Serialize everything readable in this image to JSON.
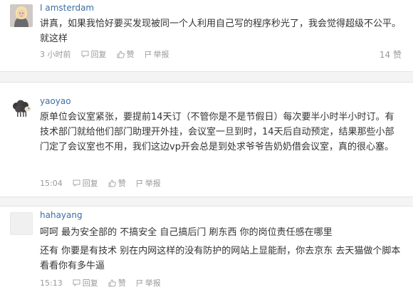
{
  "comments": [
    {
      "author": "I amsterdam",
      "body": "讲真，如果我恰好要买发现被同一个人利用自己写的程序秒光了，我会觉得超级不公平。就这样",
      "time": "3 小时前",
      "reply_label": "回复",
      "like_label": "赞",
      "report_label": "举报",
      "like_count": "14 赞",
      "avatar_icon": "female-avatar-icon"
    },
    {
      "author": "yaoyao",
      "body": "原单位会议室紧张，要提前14天订（不管你是不是节假日）每次要半小时半小时订。有技术部门就给他们部门助理开外挂，会议室一旦到时，14天后自动预定，结果那些小部门定了会议室也不用，我们这边vp开会总是到处求爷爷告奶奶借会议室，真的很心塞。",
      "time": "15:04",
      "reply_label": "回复",
      "like_label": "赞",
      "report_label": "举报",
      "avatar_icon": "sheep-avatar-icon"
    },
    {
      "author": "hahayang",
      "body": "呵呵 最为安全部的 不搞安全 自己搞后门 刷东西 你的岗位责任感在哪里",
      "body2": "还有 你要是有技术 别在内网这样的没有防护的网站上显能耐，你去京东 去天猫做个脚本 看看你有多牛逼",
      "time": "15:13",
      "reply_label": "回复",
      "like_label": "赞",
      "report_label": "举报",
      "avatar_icon": "default-avatar-icon"
    }
  ]
}
